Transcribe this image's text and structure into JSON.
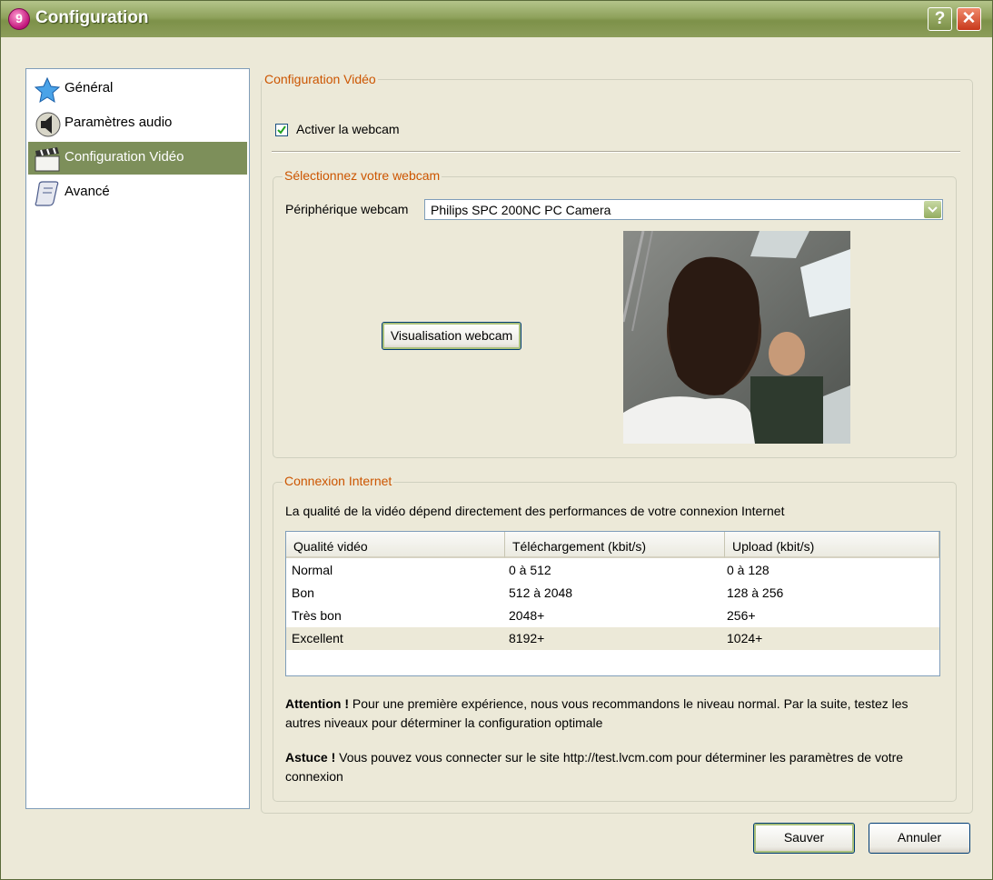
{
  "window": {
    "title": "Configuration",
    "help_btn": "?",
    "close_btn": "✕"
  },
  "sidebar": {
    "items": [
      {
        "label": "Général",
        "icon": "star-icon"
      },
      {
        "label": "Paramètres audio",
        "icon": "speaker-icon"
      },
      {
        "label": "Configuration Vidéo",
        "icon": "clapperboard-icon",
        "selected": true
      },
      {
        "label": "Avancé",
        "icon": "scroll-icon"
      }
    ]
  },
  "video_config": {
    "legend": "Configuration Vidéo",
    "enable_webcam_label": "Activer la webcam",
    "enable_webcam_checked": true
  },
  "webcam_select": {
    "legend": "Sélectionnez votre webcam",
    "device_label": "Périphérique webcam",
    "device_value": "Philips SPC 200NC PC Camera",
    "preview_button": "Visualisation webcam"
  },
  "connection": {
    "legend": "Connexion Internet",
    "description": "La qualité de la vidéo dépend directement des performances de votre connexion Internet",
    "columns": [
      "Qualité vidéo",
      "Téléchargement (kbit/s)",
      "Upload (kbit/s)"
    ],
    "rows": [
      [
        "Normal",
        "0 à 512",
        "0 à 128"
      ],
      [
        "Bon",
        "512 à 2048",
        "128 à 256"
      ],
      [
        "Très bon",
        "2048+",
        "256+"
      ],
      [
        "Excellent",
        "8192+",
        "1024+"
      ]
    ],
    "attention_title": "Attention !",
    "attention_text": " Pour une première expérience, nous vous recommandons le niveau normal. Par la suite, testez les autres niveaux pour déterminer la configuration optimale",
    "tip_title": "Astuce !",
    "tip_text": " Vous pouvez vous connecter sur le site http://test.lvcm.com pour déterminer les paramètres de votre connexion"
  },
  "footer": {
    "save_label": "Sauver",
    "cancel_label": "Annuler"
  },
  "colors": {
    "title_bar": "#7d9149",
    "selected_item": "#7d8f5a",
    "legend_text": "#cc5500",
    "dialog_bg": "#ECE9D8"
  }
}
